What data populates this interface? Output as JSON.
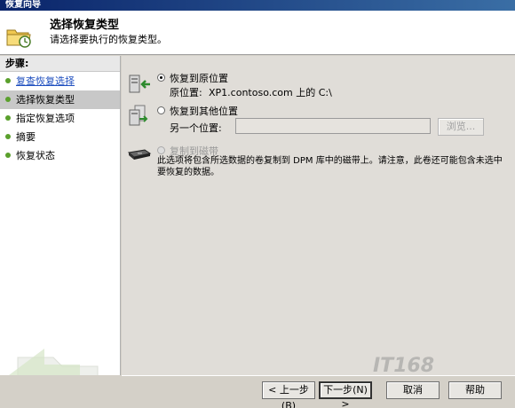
{
  "window": {
    "title": "恢复向导"
  },
  "header": {
    "title": "选择恢复类型",
    "subtitle": "请选择要执行的恢复类型。",
    "icon": "folder-clock-icon"
  },
  "steps": {
    "heading": "步骤:",
    "items": [
      {
        "label": "复查恢复选择",
        "state": "done"
      },
      {
        "label": "选择恢复类型",
        "state": "current"
      },
      {
        "label": "指定恢复选项",
        "state": "pending"
      },
      {
        "label": "摘要",
        "state": "pending"
      },
      {
        "label": "恢复状态",
        "state": "pending"
      }
    ]
  },
  "options": {
    "original": {
      "label": "恢复到原位置",
      "location_label": "原位置:",
      "location_value": "XP1.contoso.com 上的 C:\\",
      "selected": true,
      "icon": "server-restore-icon"
    },
    "alternate": {
      "label": "恢复到其他位置",
      "field_label": "另一个位置:",
      "field_value": "",
      "browse_label": "浏览...",
      "selected": false,
      "icon": "server-alternate-icon"
    },
    "tape": {
      "label": "复制到磁带",
      "description": "此选项将包含所选数据的卷复制到 DPM 库中的磁带上。请注意，此卷还可能包含未选中要恢复的数据。",
      "enabled": false,
      "icon": "tape-drive-icon"
    }
  },
  "footer": {
    "back": "< 上一步(B)",
    "next": "下一步(N) >",
    "cancel": "取消",
    "help": "帮助"
  },
  "watermark_text": "IT168"
}
